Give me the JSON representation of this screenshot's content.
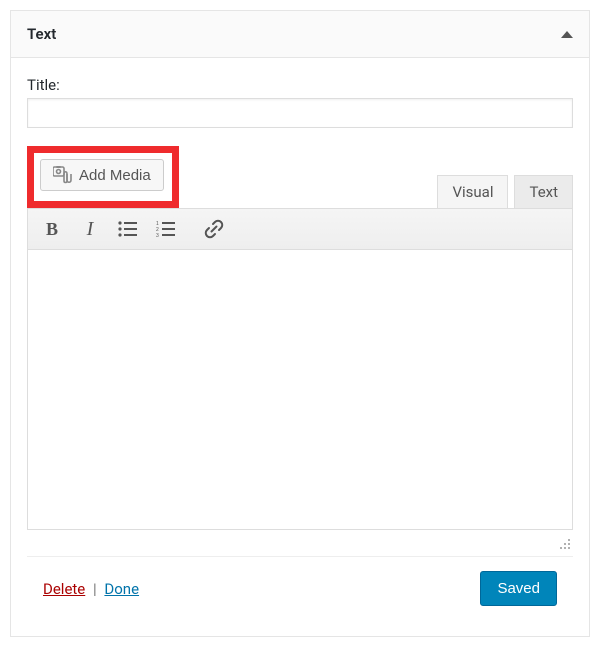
{
  "widget": {
    "title": "Text"
  },
  "fields": {
    "title_label": "Title:",
    "title_value": ""
  },
  "media": {
    "add_label": "Add Media"
  },
  "tabs": {
    "visual": "Visual",
    "text": "Text",
    "active": "visual"
  },
  "toolbar": {
    "bold": "B",
    "italic": "I"
  },
  "editor": {
    "content": ""
  },
  "footer": {
    "delete_label": "Delete",
    "separator": "|",
    "done_label": "Done",
    "saved_label": "Saved"
  },
  "colors": {
    "highlight": "#ef2b2d",
    "primary": "#0085ba",
    "link": "#0073aa",
    "danger": "#a00"
  }
}
